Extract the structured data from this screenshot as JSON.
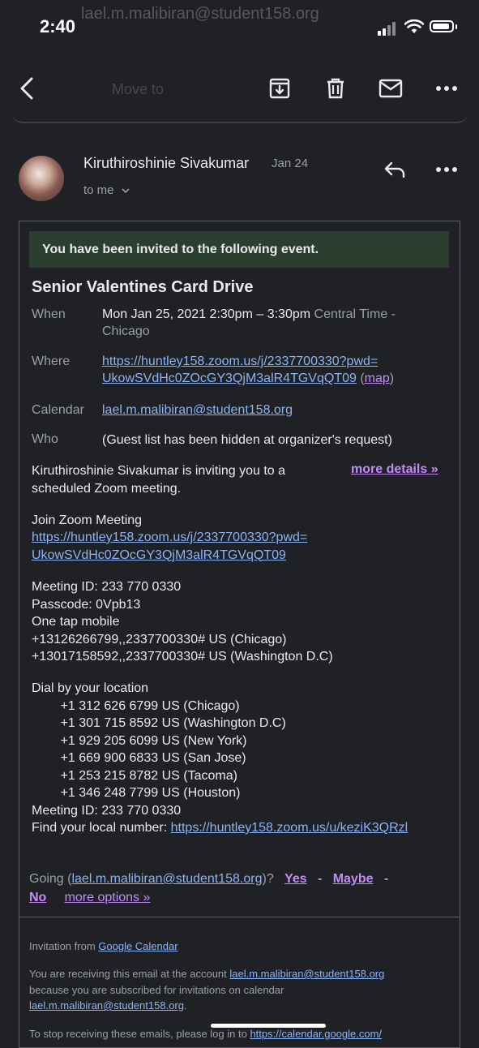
{
  "status": {
    "time": "2:40",
    "ghost_line": "lael.m.malibiran@student158.org",
    "ghost_subject": "Move to"
  },
  "toolbar": {
    "icons": [
      "back-arrow-icon",
      "archive-icon",
      "trash-icon",
      "mail-icon",
      "more-icon"
    ]
  },
  "message": {
    "sender": "Kiruthiroshinie Sivakumar",
    "date": "Jan 24",
    "to": "to me"
  },
  "invite": {
    "banner": "You have been invited to the following event.",
    "title": "Senior Valentines Card Drive",
    "when_label": "When",
    "when_value": "Mon Jan 25, 2021 2:30pm – 3:30pm",
    "when_tz": "Central Time -",
    "when_tz2": "Chicago",
    "where_label": "Where",
    "where_link1": "https://huntley158.zoom.us/j/2337700330?pwd=",
    "where_link2": "UkowSVdHc0ZOcGY3QjM3alR4TGVqQT09",
    "map_label": "map",
    "calendar_label": "Calendar",
    "calendar_value": "lael.m.malibiran@student158.org",
    "who_label": "Who",
    "who_value": "(Guest list has been hidden at organizer's request)",
    "more_details": "more details »",
    "desc1": "Kiruthiroshinie Sivakumar is inviting you to a",
    "desc2": "scheduled Zoom meeting.",
    "join_heading": "Join Zoom Meeting",
    "join_link1": "https://huntley158.zoom.us/j/2337700330?pwd=",
    "join_link2": "UkowSVdHc0ZOcGY3QjM3alR4TGVqQT09",
    "meeting_lines": "Meeting ID: 233 770 0330\nPasscode: 0Vpb13\nOne tap mobile\n+13126266799,,2337700330# US (Chicago)\n+13017158592,,2337700330# US (Washington D.C)",
    "dial_lines": "Dial by your location\n        +1 312 626 6799 US (Chicago)\n        +1 301 715 8592 US (Washington D.C)\n        +1 929 205 6099 US (New York)\n        +1 669 900 6833 US (San Jose)\n        +1 253 215 8782 US (Tacoma)\n        +1 346 248 7799 US (Houston)\nMeeting ID: 233 770 0330",
    "find_local": "Find your local number: ",
    "find_local_link": "https://huntley158.zoom.us/u/keziK3QRzl",
    "going_prefix": "Going (",
    "going_email": "lael.m.malibiran@student158.org",
    "going_suffix": ")?",
    "yes": "Yes",
    "maybe": "Maybe",
    "no": "No",
    "dash": "-",
    "more_options": "more options »"
  },
  "footer": {
    "invitation_from": "Invitation from ",
    "google_calendar": "Google Calendar",
    "receiving1": "You are receiving this email at the account ",
    "account": "lael.m.malibiran@student158.org",
    "receiving2": "because you are subscribed for invitations on calendar",
    "calendar": "lael.m.malibiran@student158.org",
    "period": ".",
    "stop": "To stop receiving these emails, please log in to ",
    "stop_link": "https://calendar.google.com/"
  }
}
